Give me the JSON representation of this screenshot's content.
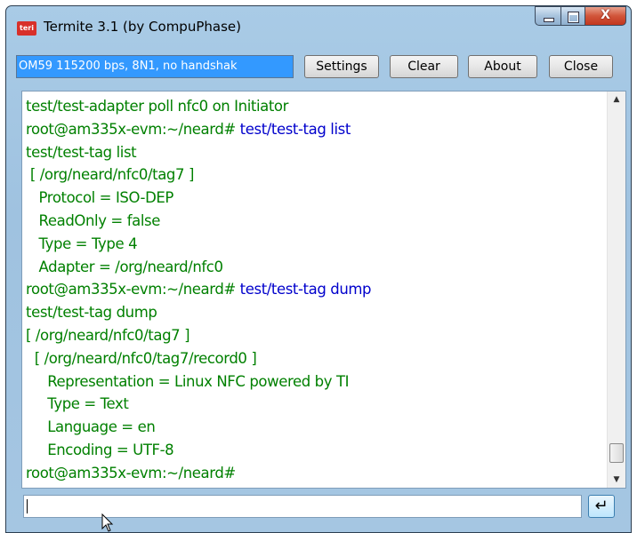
{
  "window": {
    "title": "Termite 3.1 (by CompuPhase)",
    "icon": "termite-app-icon",
    "icon_text": "teri"
  },
  "caption_buttons": {
    "minimize": "minimize-icon",
    "maximize": "maximize-icon",
    "close_glyph": "X"
  },
  "toolbar": {
    "port_settings": "OM59 115200 bps, 8N1, no handshak",
    "settings_label": "Settings",
    "clear_label": "Clear",
    "about_label": "About",
    "close_label": "Close"
  },
  "terminal": {
    "lines": [
      {
        "text": "test/test-adapter poll nfc0 on Initiator"
      },
      {
        "prompt": "root@am335x-evm:~/neard# ",
        "cmd": "test/test-tag list"
      },
      {
        "text": "test/test-tag list"
      },
      {
        "text": " [ /org/neard/nfc0/tag7 ]"
      },
      {
        "text": "   Protocol = ISO-DEP"
      },
      {
        "text": "   ReadOnly = false"
      },
      {
        "text": "   Type = Type 4"
      },
      {
        "text": "   Adapter = /org/neard/nfc0"
      },
      {
        "prompt": "root@am335x-evm:~/neard# ",
        "cmd": "test/test-tag dump"
      },
      {
        "text": "test/test-tag dump"
      },
      {
        "text": "[ /org/neard/nfc0/tag7 ]"
      },
      {
        "text": "  [ /org/neard/nfc0/tag7/record0 ]"
      },
      {
        "text": "     Representation = Linux NFC powered by TI"
      },
      {
        "text": "     Type = Text"
      },
      {
        "text": "     Language = en"
      },
      {
        "text": "     Encoding = UTF-8"
      },
      {
        "prompt": "root@am335x-evm:~/neard#",
        "cmd": ""
      }
    ],
    "output_color": "#008000",
    "command_color": "#0000cc"
  },
  "input": {
    "value": "",
    "send_icon": "enter-return-icon",
    "send_glyph": "↵"
  },
  "colors": {
    "selection": "#3399ff",
    "frame": "#a9cbe6",
    "close_button": "#c2361e"
  }
}
